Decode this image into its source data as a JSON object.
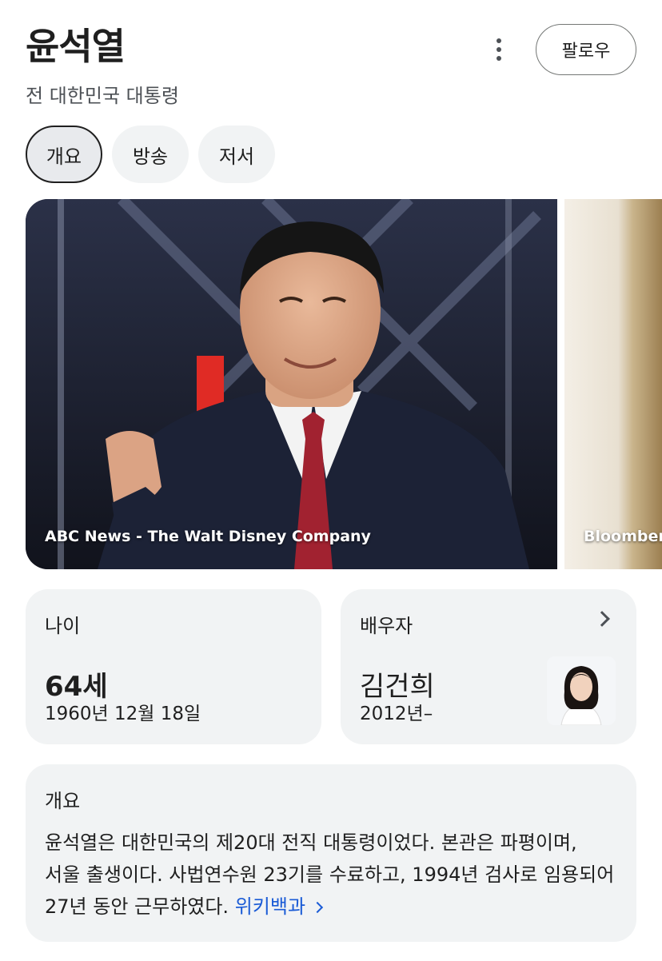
{
  "header": {
    "title": "윤석열",
    "subtitle": "전 대한민국 대통령",
    "follow_label": "팔로우",
    "more_icon": "more-vert-icon"
  },
  "tabs": [
    {
      "label": "개요",
      "selected": true
    },
    {
      "label": "방송",
      "selected": false
    },
    {
      "label": "저서",
      "selected": false
    }
  ],
  "gallery": [
    {
      "caption": "ABC News - The Walt Disney Company"
    },
    {
      "caption": "Bloomberg"
    }
  ],
  "facts": {
    "age": {
      "label": "나이",
      "value": "64세",
      "detail": "1960년 12월 18일"
    },
    "spouse": {
      "label": "배우자",
      "value": "김건희",
      "detail": "2012년–"
    }
  },
  "overview": {
    "label": "개요",
    "text": "윤석열은 대한민국의 제20대 전직 대통령이었다. 본관은 파평이며, 서울 출생이다. 사법연수원 23기를 수료하고, 1994년 검사로 임용되어 27년 동안 근무하였다.",
    "link_label": "위키백과"
  },
  "colors": {
    "link": "#1a5bd6",
    "card_bg": "#f1f3f4"
  }
}
